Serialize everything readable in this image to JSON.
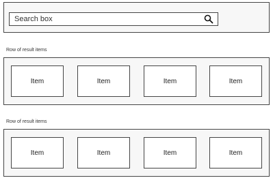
{
  "search": {
    "placeholder": "Search box",
    "icon": "search-icon"
  },
  "rows": [
    {
      "label": "Row of result items",
      "items": [
        "Item",
        "Item",
        "Item",
        "Item"
      ]
    },
    {
      "label": "Row of result items",
      "items": [
        "Item",
        "Item",
        "Item",
        "Item"
      ]
    }
  ]
}
